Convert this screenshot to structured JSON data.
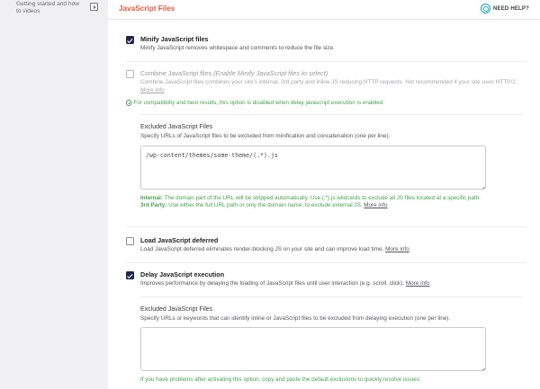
{
  "sidebar": {
    "item_label": "Getting started and how to videos",
    "item_icon": "play-video-icon"
  },
  "header": {
    "title": "JavaScript Files",
    "need_help": "NEED HELP?",
    "help_icon": "lifebuoy-icon"
  },
  "minify": {
    "checked": true,
    "title": "Minify JavaScript files",
    "description": "Minify JavaScript removes whitespace and comments to reduce the file size."
  },
  "combine": {
    "checked": false,
    "disabled": true,
    "title": "Combine JavaScript files ",
    "title_em": "(Enable Minify JavaScript files to select)",
    "description": "Combine JavaScript files combines your site’s internal, 3rd party and inline JS reducing HTTP requests. Not recommended if your site uses HTTP/2.",
    "more_info": "More info",
    "notice": "For compatibility and best results, this option is disabled when delay javascript execution is enabled."
  },
  "excluded_minify": {
    "title": "Excluded JavaScript Files",
    "description": "Specify URLs of JavaScript files to be excluded from minification and concatenation (one per line).",
    "textarea_value": "/wp-content/themes/some-theme/(.*).js",
    "internal_label": "Internal:",
    "internal_text": "The domain part of the URL will be stripped automatically. Use (.*).js wildcards to exclude all JS files located at a specific path.",
    "third_party_label": "3rd Party:",
    "third_party_text": "Use either the full URL path or only the domain name, to exclude external JS.",
    "more_info": "More info"
  },
  "load_deferred": {
    "checked": false,
    "title": "Load JavaScript deferred",
    "description": "Load JavaScript deferred eliminates render-blocking JS on your site and can improve load time.",
    "more_info": "More info"
  },
  "delay_execution": {
    "checked": true,
    "title": "Delay JavaScript execution",
    "description": "Improves performance by delaying the loading of JavaScript files until user interaction (e.g. scroll, click).",
    "more_info": "More info"
  },
  "excluded_delay": {
    "title": "Excluded JavaScript Files",
    "description": "Specify URLs or keywords that can identify inline or JavaScript files to be excluded from delaying execution (one per line).",
    "textarea_value": "",
    "footer_note": "If you have problems after activating this option, copy and paste the default exclusions to quickly resolve issues:"
  },
  "colors": {
    "accent": "#e25d3b",
    "help": "#17a2b8",
    "success": "#46a24d",
    "checkbox": "#1e2a4a"
  }
}
